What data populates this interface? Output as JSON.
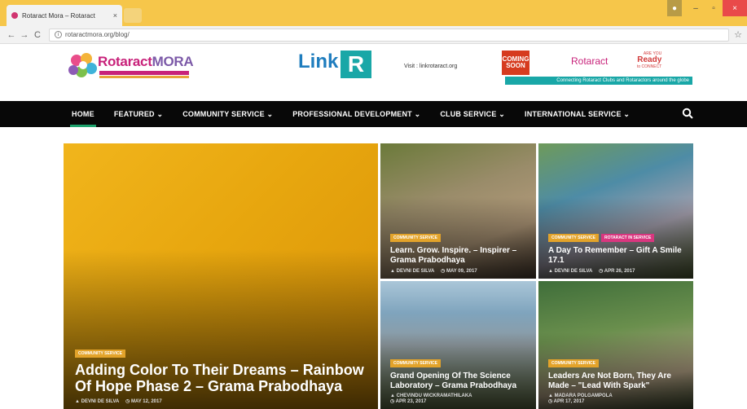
{
  "browser": {
    "tab_title": "Rotaract Mora – Rotaract",
    "tab_close": "×",
    "url": "rotaractmora.org/blog/",
    "back": "←",
    "forward": "→",
    "reload": "C",
    "bookmark": "☆",
    "window_min": "–",
    "window_max": "▫",
    "window_close": "×"
  },
  "header": {
    "logo_brand": "Rotaract",
    "logo_brand_accent": "MORA",
    "banner_link": "Link",
    "banner_link_r": "R",
    "banner_visit": "Visit : linkrotaract.org",
    "banner_soon": "COMING SOON",
    "banner_rotaract": "Rotaract",
    "banner_ready_small": "ARE YOU",
    "banner_ready": "Ready",
    "banner_ready_sub": "to CONNECT",
    "banner_strip": "Connecting Rotaract Clubs and Rotaractors around the globe"
  },
  "nav": {
    "items": [
      {
        "label": "HOME"
      },
      {
        "label": "FEATURED ⌄"
      },
      {
        "label": "COMMUNITY SERVICE ⌄"
      },
      {
        "label": "PROFESSIONAL DEVELOPMENT ⌄"
      },
      {
        "label": "CLUB SERVICE ⌄"
      },
      {
        "label": "INTERNATIONAL SERVICE ⌄"
      }
    ]
  },
  "posts": [
    {
      "category": "COMMUNITY SERVICE",
      "title": "Adding Color To Their Dreams – Rainbow Of Hope Phase 2 – Grama Prabodhaya",
      "author": "▲ DEVNI DE SILVA",
      "date": "◷ MAY 12, 2017"
    },
    {
      "category": "COMMUNITY SERVICE",
      "title": "Learn. Grow. Inspire. – Inspirer – Grama Prabodhaya",
      "author": "▲ DEVNI DE SILVA",
      "date": "◷ MAY 09, 2017"
    },
    {
      "category": "COMMUNITY SERVICE",
      "category2": "ROTARACT IN SERVICE",
      "title": "A Day To Remember – Gift A Smile 17.1",
      "author": "▲ DEVNI DE SILVA",
      "date": "◷ APR 26, 2017"
    },
    {
      "category": "COMMUNITY SERVICE",
      "title": "Grand Opening Of The Science Laboratory – Grama Prabodhaya",
      "author": "▲ CHEVINDU WICKRAMATHILAKA",
      "date": "◷ APR 23, 2017"
    },
    {
      "category": "COMMUNITY SERVICE",
      "title": "Leaders Are Not Born, They Are Made – \"Lead With Spark\"",
      "author": "▲ MADARA POLGAMPOLA",
      "date": "◷ APR 17, 2017"
    }
  ]
}
